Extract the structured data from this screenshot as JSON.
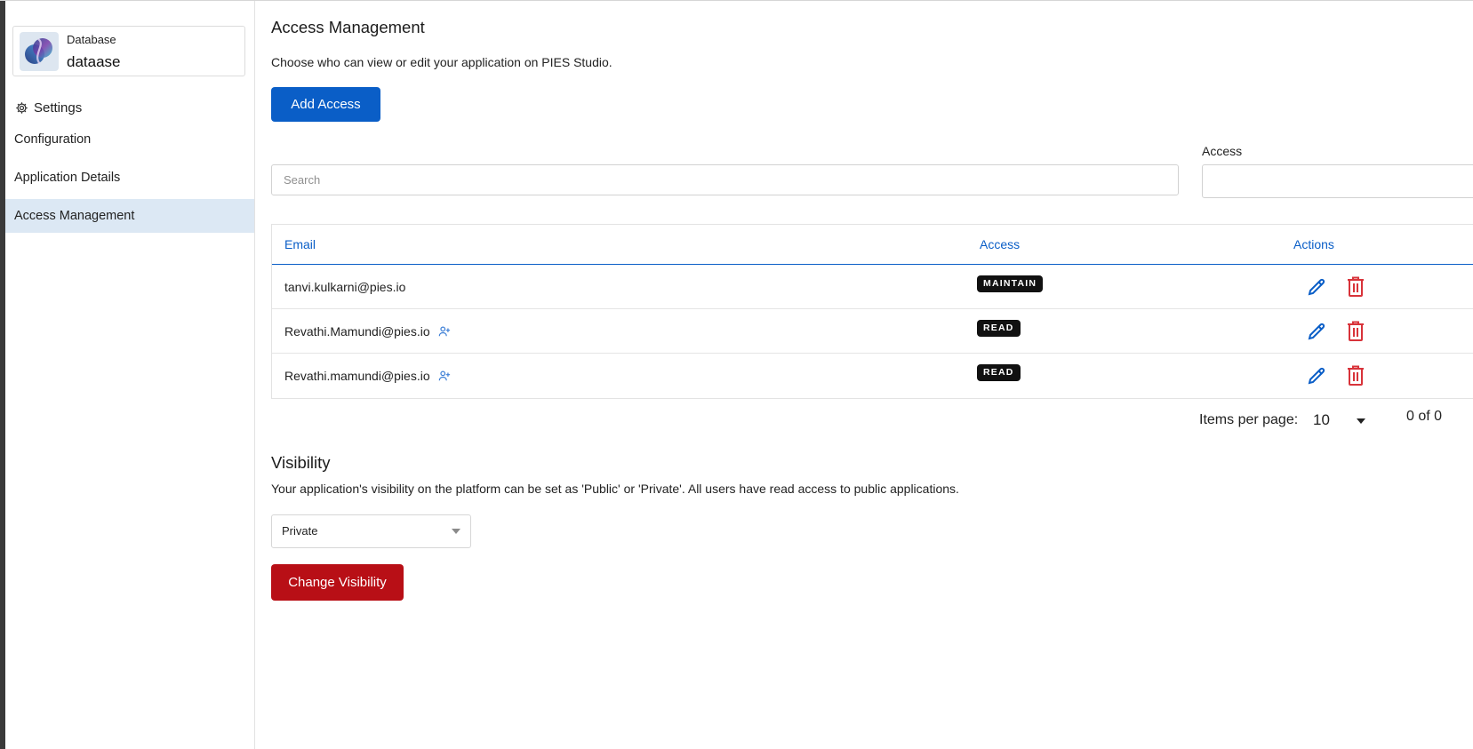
{
  "sidebar": {
    "db_card": {
      "type_label": "Database",
      "name": "dataase"
    },
    "settings_label": "Settings",
    "items": [
      {
        "label": "Configuration",
        "active": false
      },
      {
        "label": "Application Details",
        "active": false
      },
      {
        "label": "Access Management",
        "active": true
      }
    ]
  },
  "main": {
    "title": "Access Management",
    "description": "Choose who can view or edit your application on PIES Studio.",
    "add_button": "Add Access",
    "search_placeholder": "Search",
    "access_filter_label": "Access",
    "access_filter_value": "",
    "table": {
      "columns": [
        "Email",
        "Access",
        "Actions"
      ],
      "rows": [
        {
          "email": "tanvi.kulkarni@pies.io",
          "access": "MAINTAIN",
          "pending_icon": false
        },
        {
          "email": "Revathi.Mamundi@pies.io",
          "access": "READ",
          "pending_icon": true
        },
        {
          "email": "Revathi.mamundi@pies.io",
          "access": "READ",
          "pending_icon": true
        }
      ]
    },
    "pagination": {
      "label": "Items per page:",
      "page_size": "10",
      "range": "0 of 0"
    },
    "visibility": {
      "title": "Visibility",
      "description": "Your application's visibility on the platform can be set as 'Public' or 'Private'. All users have read access to public applications.",
      "selected": "Private",
      "button": "Change Visibility"
    }
  },
  "colors": {
    "primary": "#0a5ec7",
    "danger": "#b80f16",
    "active_nav": "#dce8f4",
    "badge": "#111111",
    "delete_icon": "#d8333a"
  },
  "icons": {
    "settings": "gear-icon",
    "edit": "pencil-icon",
    "delete": "trash-icon",
    "pending": "user-add-icon",
    "dropdown": "caret-down-icon"
  }
}
